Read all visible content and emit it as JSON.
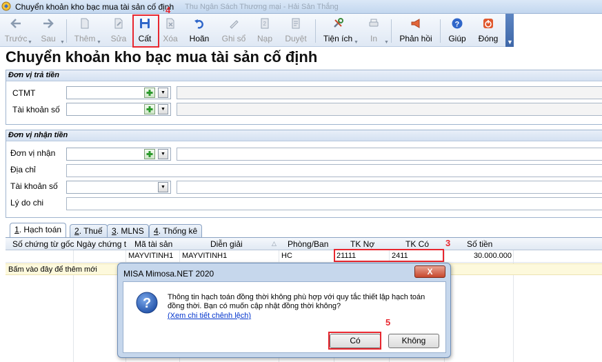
{
  "window": {
    "title": "Chuyển khoản kho bạc mua tài sản cố định",
    "ghost_title": "Thu Ngân Sách Thương mại - Hải Sản Thắng"
  },
  "toolbar": {
    "back": "Trước",
    "next": "Sau",
    "add": "Thêm",
    "edit": "Sửa",
    "save": "Cất",
    "delete": "Xóa",
    "undo": "Hoãn",
    "post": "Ghi sổ",
    "load": "Nạp",
    "approve": "Duyệt",
    "utilities": "Tiện ích",
    "print": "In",
    "feedback": "Phản hồi",
    "help": "Giúp",
    "close": "Đóng"
  },
  "annotations": {
    "step3": "3",
    "step4": "4",
    "step5": "5"
  },
  "page_title": "Chuyển khoản kho bạc mua tài sản cố định",
  "payer": {
    "header": "Đơn vị trả tiền",
    "ctmt_label": "CTMT",
    "account_label": "Tài khoản số"
  },
  "payee": {
    "header": "Đơn vị nhận tiền",
    "unit_label": "Đơn vị nhận",
    "address_label": "Địa chỉ",
    "account_label": "Tài khoản số",
    "reason_label": "Lý do chi"
  },
  "tabs": [
    {
      "num": "1",
      "label": ". Hạch toán"
    },
    {
      "num": "2",
      "label": ". Thuế"
    },
    {
      "num": "3",
      "label": ". MLNS"
    },
    {
      "num": "4",
      "label": ". Thống kê"
    }
  ],
  "grid": {
    "headers": [
      "Số chứng từ gốc",
      "Ngày chứng t",
      "Mã tài sản",
      "Diễn giải",
      "Phòng/Ban",
      "TK Nợ",
      "TK Có",
      "Số tiền"
    ],
    "row": [
      "",
      "",
      "MAYVITINH1",
      "MAYVITINH1",
      "HC",
      "21111",
      "2411",
      "30.000.000"
    ],
    "add_row_text": "Bấm vào đây để thêm mới"
  },
  "dialog": {
    "title": "MISA Mimosa.NET 2020",
    "close": "X",
    "message": "Thông tin hạch toán đồng thời không phù hợp với quy tắc thiết lập hạch toán đồng thời. Bạn có muốn cập nhật đồng thời không?",
    "link": "(Xem chi tiết chênh lệch)",
    "yes": "Có",
    "no": "Không"
  }
}
